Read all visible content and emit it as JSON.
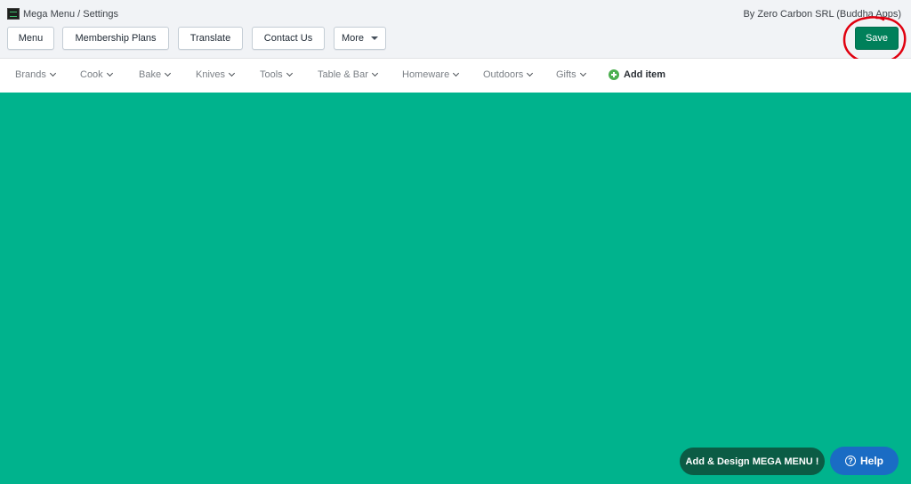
{
  "header": {
    "breadcrumb": "Mega Menu / Settings",
    "byline": "By Zero Carbon SRL (Buddha Apps)",
    "logo_icon": "app-logo-icon"
  },
  "toolbar": {
    "buttons": [
      {
        "label": "Menu"
      },
      {
        "label": "Membership Plans"
      },
      {
        "label": "Translate"
      },
      {
        "label": "Contact Us"
      },
      {
        "label": "More"
      }
    ],
    "save_label": "Save",
    "save_color": "#00805a",
    "annotation_color": "#e0000f"
  },
  "nav": {
    "items": [
      {
        "label": "Brands"
      },
      {
        "label": "Cook"
      },
      {
        "label": "Bake"
      },
      {
        "label": "Knives"
      },
      {
        "label": "Tools"
      },
      {
        "label": "Table & Bar"
      },
      {
        "label": "Homeware"
      },
      {
        "label": "Outdoors"
      },
      {
        "label": "Gifts"
      }
    ],
    "add_item_label": "Add item"
  },
  "canvas": {
    "background": "#00b38d"
  },
  "floating": {
    "design_label": "Add & Design MEGA MENU !",
    "help_label": "Help",
    "help_icon_glyph": "?"
  }
}
